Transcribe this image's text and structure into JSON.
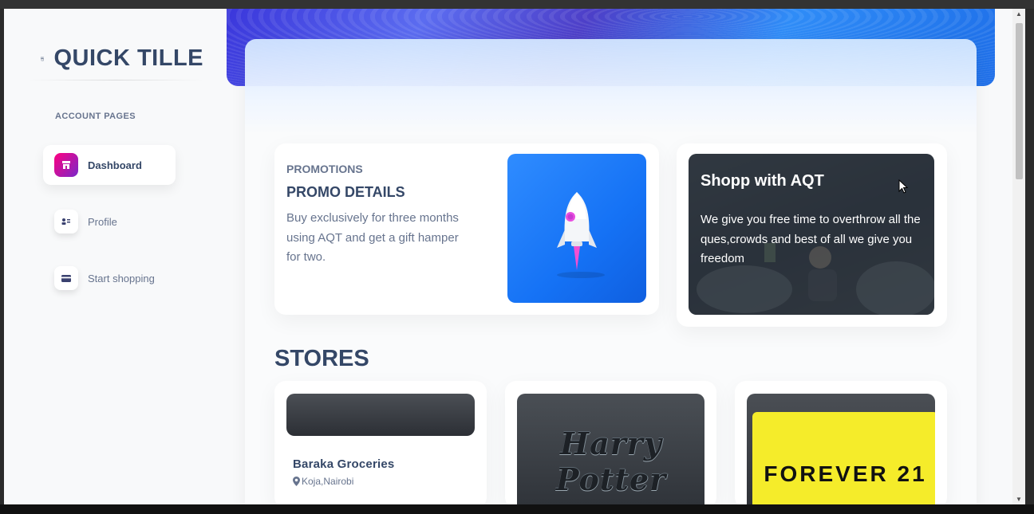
{
  "brand": {
    "name": "QUICK TILLE",
    "icon": "shop-logo-icon"
  },
  "sidebar": {
    "section_title": "ACCOUNT PAGES",
    "items": [
      {
        "label": "Dashboard",
        "icon": "shop-icon",
        "active": true
      },
      {
        "label": "Profile",
        "icon": "user-card-icon",
        "active": false
      },
      {
        "label": "Start shopping",
        "icon": "credit-card-icon",
        "active": false
      }
    ]
  },
  "promo": {
    "kicker": "PROMOTIONS",
    "title": "PROMO DETAILS",
    "description": "Buy exclusively for three months using AQT and get a gift hamper for two.",
    "image_icon": "rocket-icon"
  },
  "shopp": {
    "title": "Shopp with AQT",
    "description": "We give you free time to overthrow all the ques,crowds and best of all we give you freedom"
  },
  "stores": {
    "title": "STORES",
    "items": [
      {
        "name": "Baraka Groceries",
        "location": "Koja,Nairobi"
      },
      {
        "logo_text": "Harry Potter"
      },
      {
        "logo_text": "FOREVER 21"
      }
    ]
  },
  "colors": {
    "primary_text": "#344767",
    "secondary_text": "#67748e",
    "accent_pink": "#ff0080",
    "promo_blue": "#1572f5",
    "forever21_yellow": "#f5ec2a"
  }
}
